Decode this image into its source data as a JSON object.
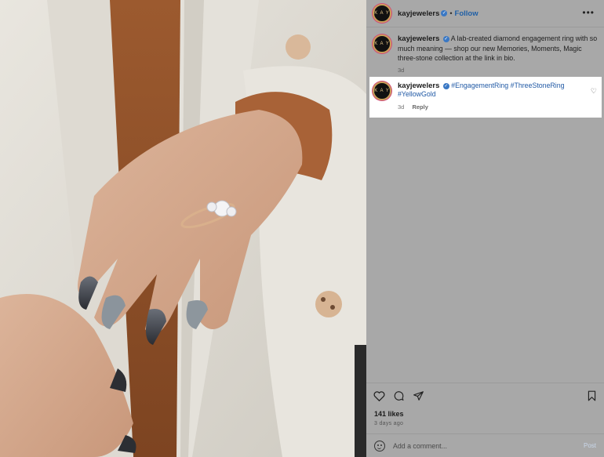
{
  "header": {
    "username": "kayjewelers",
    "separator": "•",
    "follow_label": "Follow",
    "more_label": "•••",
    "avatar_text": "K A Y"
  },
  "caption": {
    "username": "kayjewelers",
    "text": "A lab-created diamond engagement ring with so much meaning — shop our new Memories, Moments, Magic three-stone collection at the link in bio.",
    "age": "3d"
  },
  "comment": {
    "username": "kayjewelers",
    "hashtags": [
      "#EngagementRing",
      "#ThreeStoneRing",
      "#YellowGold"
    ],
    "age": "3d",
    "reply_label": "Reply"
  },
  "footer": {
    "likes": "141 likes",
    "date": "3 days ago",
    "comment_placeholder": "Add a comment...",
    "post_label": "Post"
  },
  "icons": {
    "like": "heart-icon",
    "comment": "comment-icon",
    "share": "share-icon",
    "save": "bookmark-icon",
    "emoji": "emoji-icon",
    "more": "more-icon"
  },
  "colors": {
    "follow": "#1f5fa6",
    "hashtag": "#2059a5",
    "verified": "#3a78c4",
    "panel_overlay": "#a8a8a8"
  }
}
